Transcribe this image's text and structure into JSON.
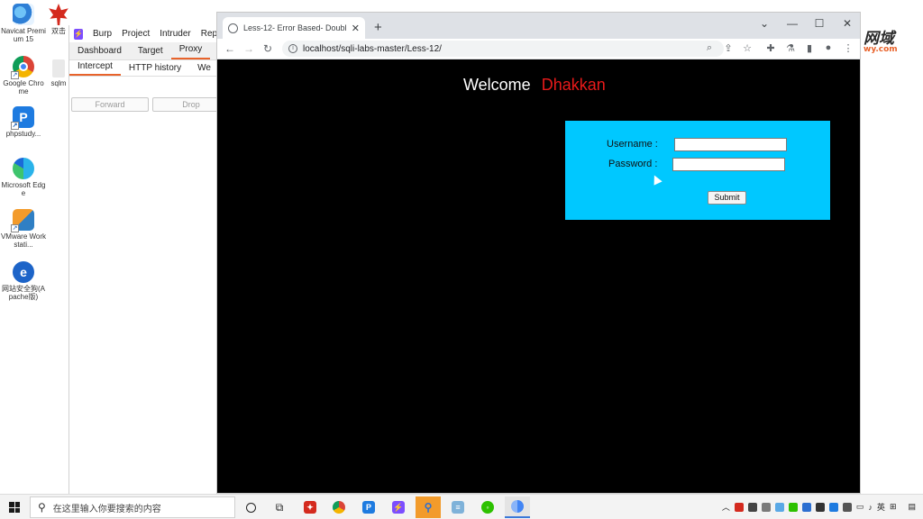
{
  "desktop": {
    "icons": [
      {
        "label": "Navicat Premium 15"
      },
      {
        "label": "Google Chrome"
      },
      {
        "label": "phpstudy..."
      },
      {
        "label": "Microsoft Edge"
      },
      {
        "label": "VMware Workstati..."
      },
      {
        "label": "网站安全狗(Apache版)"
      }
    ],
    "partial_icon_labels": [
      "双击",
      "sqlm"
    ],
    "watermark_top": "网域",
    "watermark_bottom": "wy.com"
  },
  "burp": {
    "menu": [
      "Burp",
      "Project",
      "Intruder",
      "Rep"
    ],
    "tabs": [
      "Dashboard",
      "Target",
      "Proxy"
    ],
    "active_tab": "Proxy",
    "subtabs": [
      "Intercept",
      "HTTP history",
      "We"
    ],
    "active_subtab": "Intercept",
    "forward_label": "Forward",
    "drop_label": "Drop"
  },
  "chrome": {
    "tab_title": "Less-12- Error Based- Double",
    "url": "localhost/sqli-labs-master/Less-12/",
    "icons": {
      "back": "back-arrow-icon",
      "forward": "forward-arrow-icon",
      "reload": "reload-icon",
      "zoom": "zoom-icon",
      "share": "share-icon",
      "bookmark": "star-icon",
      "extensions": "puzzle-icon",
      "profile": "profile-icon",
      "menu": "kebab-menu-icon"
    }
  },
  "page": {
    "welcome_word": "Welcome",
    "welcome_name": "Dhakkan",
    "username_label": "Username :",
    "password_label": "Password :",
    "username_value": "",
    "password_value": "",
    "submit_label": "Submit",
    "colors": {
      "background": "#000000",
      "form": "#00c8ff",
      "name": "#e81a1a"
    }
  },
  "taskbar": {
    "search_placeholder": "在这里输入你要搜索的内容",
    "tray_lang": "英"
  }
}
